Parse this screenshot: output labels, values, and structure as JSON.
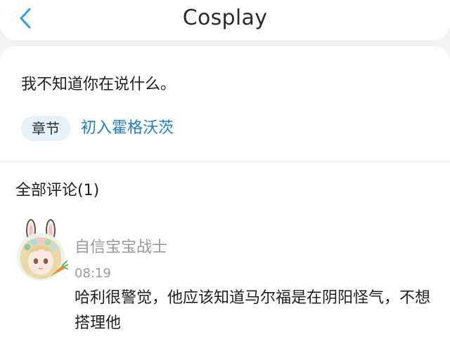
{
  "header": {
    "title": "Cosplay",
    "back_icon": "chevron-left-icon",
    "accent": "#2f9bea"
  },
  "post": {
    "text": "我不知道你在说什么。",
    "tag_label": "章节",
    "chapter_link": "初入霍格沃茨",
    "link_color": "#1e7fcd"
  },
  "comments": {
    "title": "全部评论(1)",
    "items": [
      {
        "avatar": "anime-girl-bunny-ears-avatar",
        "username": "自信宝宝战士",
        "time": "08:19",
        "text": "哈利很警觉，他应该知道马尔福是在阴阳怪气，不想搭理他"
      }
    ]
  }
}
